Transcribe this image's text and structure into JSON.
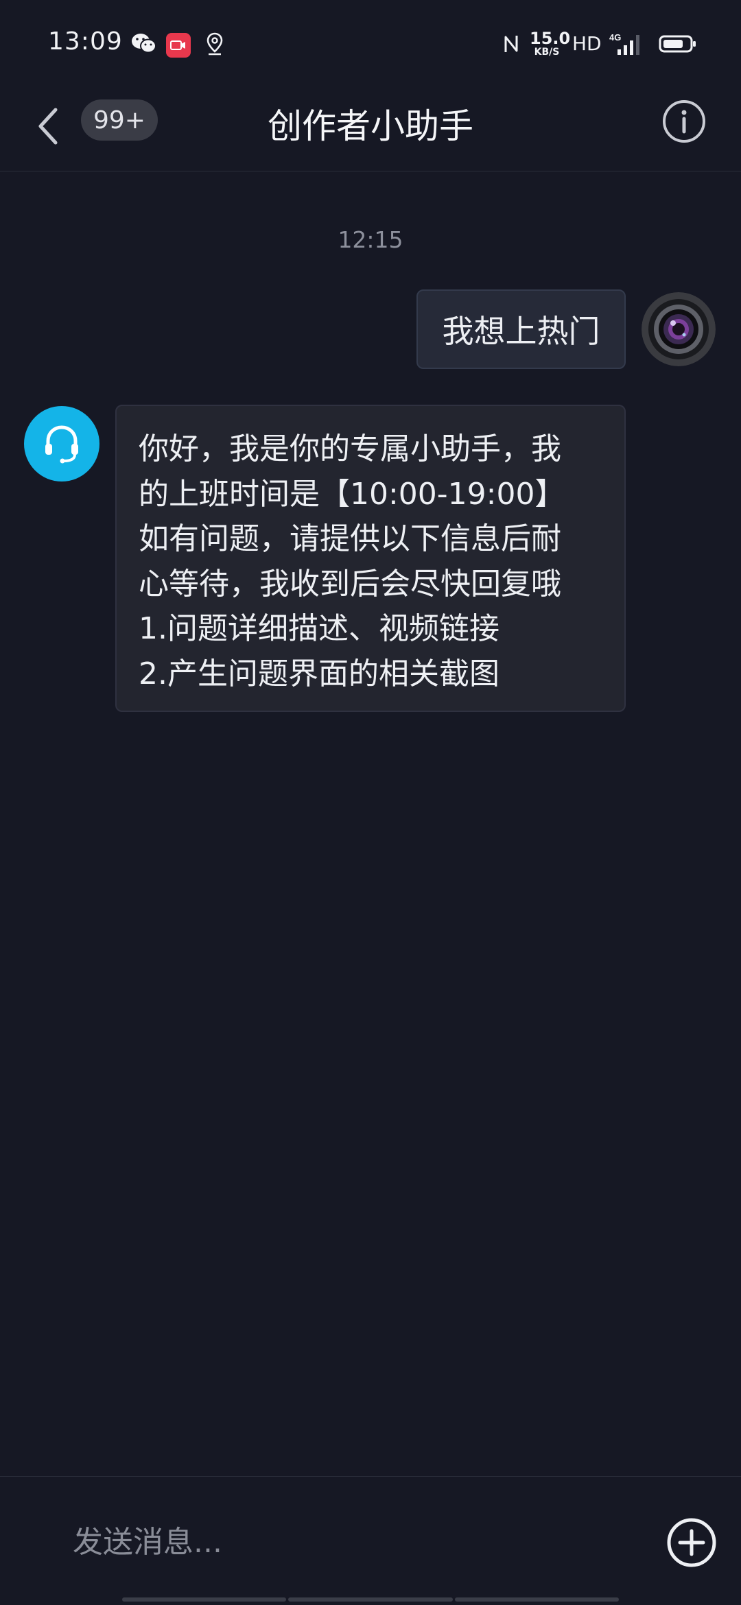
{
  "status_bar": {
    "time": "13:09",
    "net_speed_value": "15.0",
    "net_speed_unit": "KB/S",
    "hd_label": "HD",
    "network_label": "4G",
    "icons": [
      "wechat-icon",
      "screen-record-icon",
      "location-icon",
      "nfc-icon",
      "signal-icon",
      "battery-icon"
    ]
  },
  "header": {
    "back_icon": "chevron-left-icon",
    "unread_badge": "99+",
    "title": "创作者小助手",
    "info_icon": "info-icon"
  },
  "chat": {
    "timestamp": "12:15",
    "messages": [
      {
        "from": "me",
        "text": "我想上热门",
        "avatar": "camera-lens-avatar"
      },
      {
        "from": "assistant",
        "avatar": "headset-icon",
        "lines": [
          "你好，我是你的专属小助手，我",
          "的上班时间是【10:00-19:00】",
          "如有问题，请提供以下信息后耐",
          "心等待，我收到后会尽快回复哦",
          "1.问题详细描述、视频链接",
          "2.产生问题界面的相关截图"
        ]
      }
    ]
  },
  "input_bar": {
    "placeholder": "发送消息...",
    "value": "",
    "add_icon": "plus-circle-icon"
  },
  "colors": {
    "background": "#161824",
    "bubble_out": "#262a38",
    "bubble_in": "#23252f",
    "bot_avatar": "#14b4e8",
    "record_badge": "#e8384d"
  }
}
